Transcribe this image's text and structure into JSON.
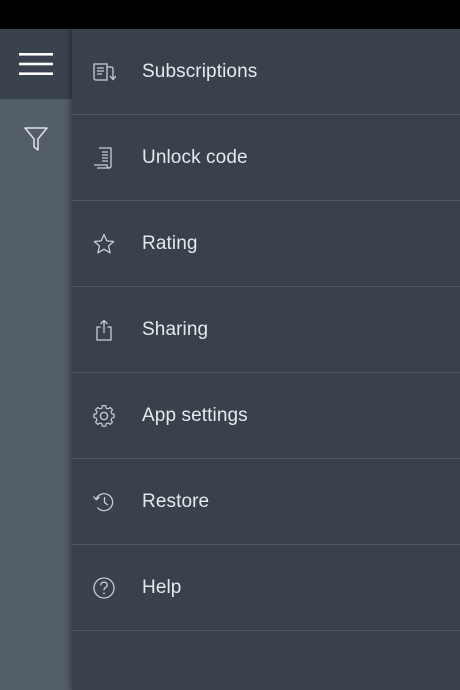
{
  "rail": {
    "menu_icon": "hamburger-menu-icon",
    "filter_icon": "filter-icon"
  },
  "menu": {
    "items": [
      {
        "label": "Subscriptions",
        "icon": "subscriptions-icon"
      },
      {
        "label": "Unlock code",
        "icon": "unlock-code-icon"
      },
      {
        "label": "Rating",
        "icon": "star-icon"
      },
      {
        "label": "Sharing",
        "icon": "share-icon"
      },
      {
        "label": "App settings",
        "icon": "gear-icon"
      },
      {
        "label": "Restore",
        "icon": "restore-icon"
      },
      {
        "label": "Help",
        "icon": "help-icon"
      }
    ]
  },
  "colors": {
    "rail": "#545e68",
    "rail_menu": "#3a434d",
    "drawer": "#39424c",
    "divider": "#4f5962",
    "text": "#e6e9ec",
    "icon": "#c9ced3"
  }
}
